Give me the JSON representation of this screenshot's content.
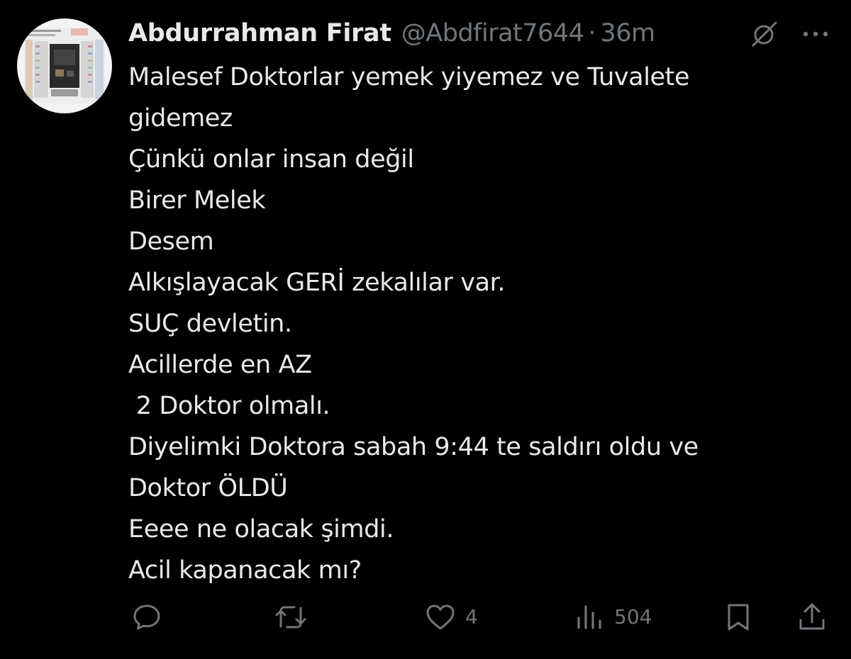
{
  "author": {
    "name": "Abdurrahman Firat",
    "handle": "@Abdfirat7644",
    "separator": "·",
    "time": "36m"
  },
  "tweet": {
    "lines": [
      "Malesef Doktorlar yemek yiyemez ve Tuvalete",
      "gidemez",
      "Çünkü onlar insan değil",
      "Birer Melek",
      "Desem",
      "Alkışlayacak GERİ zekalılar var.",
      "SUÇ devletin.",
      "Acillerde en AZ",
      " 2 Doktor olmalı.",
      "Diyelimki Doktora sabah 9:44 te saldırı oldu ve",
      "Doktor ÖLDÜ",
      "Eeee ne olacak şimdi.",
      "Acil kapanacak mı?"
    ]
  },
  "actions": {
    "reply": {
      "icon": "reply-icon"
    },
    "retweet": {
      "icon": "retweet-icon"
    },
    "like": {
      "icon": "heart-icon",
      "count": "4"
    },
    "views": {
      "icon": "views-icon",
      "count": "504"
    },
    "bookmark": {
      "icon": "bookmark-icon"
    },
    "share": {
      "icon": "share-icon"
    }
  },
  "icons": {
    "grok": "grok-icon",
    "more": "more-icon"
  },
  "colors": {
    "background": "#000000",
    "text": "#e7e9ea",
    "secondary": "#71767b"
  }
}
